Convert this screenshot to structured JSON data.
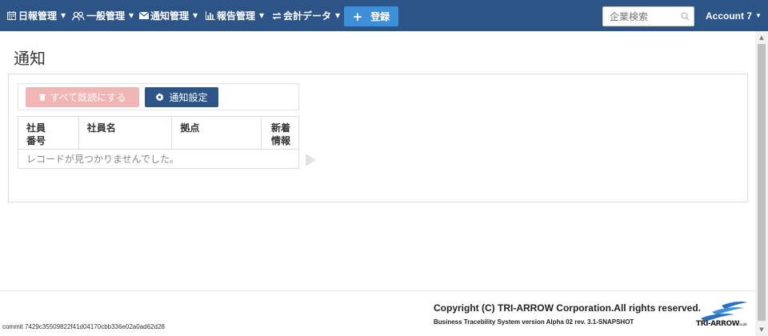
{
  "navbar": {
    "menus": [
      {
        "label": "日報管理",
        "icon": "calendar-icon"
      },
      {
        "label": "一般管理",
        "icon": "users-icon"
      },
      {
        "label": "通知管理",
        "icon": "envelope-icon"
      },
      {
        "label": "報告管理",
        "icon": "bar-chart-icon"
      },
      {
        "label": "会計データ",
        "icon": "exchange-icon"
      }
    ],
    "register_label": "登録",
    "search_placeholder": "企業検索",
    "account_label": "Account 7"
  },
  "page": {
    "title": "通知"
  },
  "toolbar": {
    "mark_all_read_label": "すべて既読にする",
    "settings_label": "通知設定"
  },
  "table": {
    "headers": {
      "employee_no_line1": "社員",
      "employee_no_line2": "番号",
      "employee_name": "社員名",
      "base": "拠点",
      "new_info_line1": "新着",
      "new_info_line2": "情報"
    },
    "empty_message": "レコードが見つかりませんでした。"
  },
  "footer": {
    "copyright": "Copyright (C) TRI-ARROW Corporation.All rights reserved.",
    "version": "Business Tracebility System version Alpha 02 rev. 3.1-SNAPSHOT",
    "commit": "commit 7429c35509822f41d04170cbb336e02a0ad62d28",
    "logo_text": "TRI-ARROW",
    "logo_suffix": "co.,ltd."
  },
  "colors": {
    "navbar": "#2d5486",
    "register_button": "#3d8fd6",
    "mark_all_read_disabled": "#f2b5b5"
  }
}
